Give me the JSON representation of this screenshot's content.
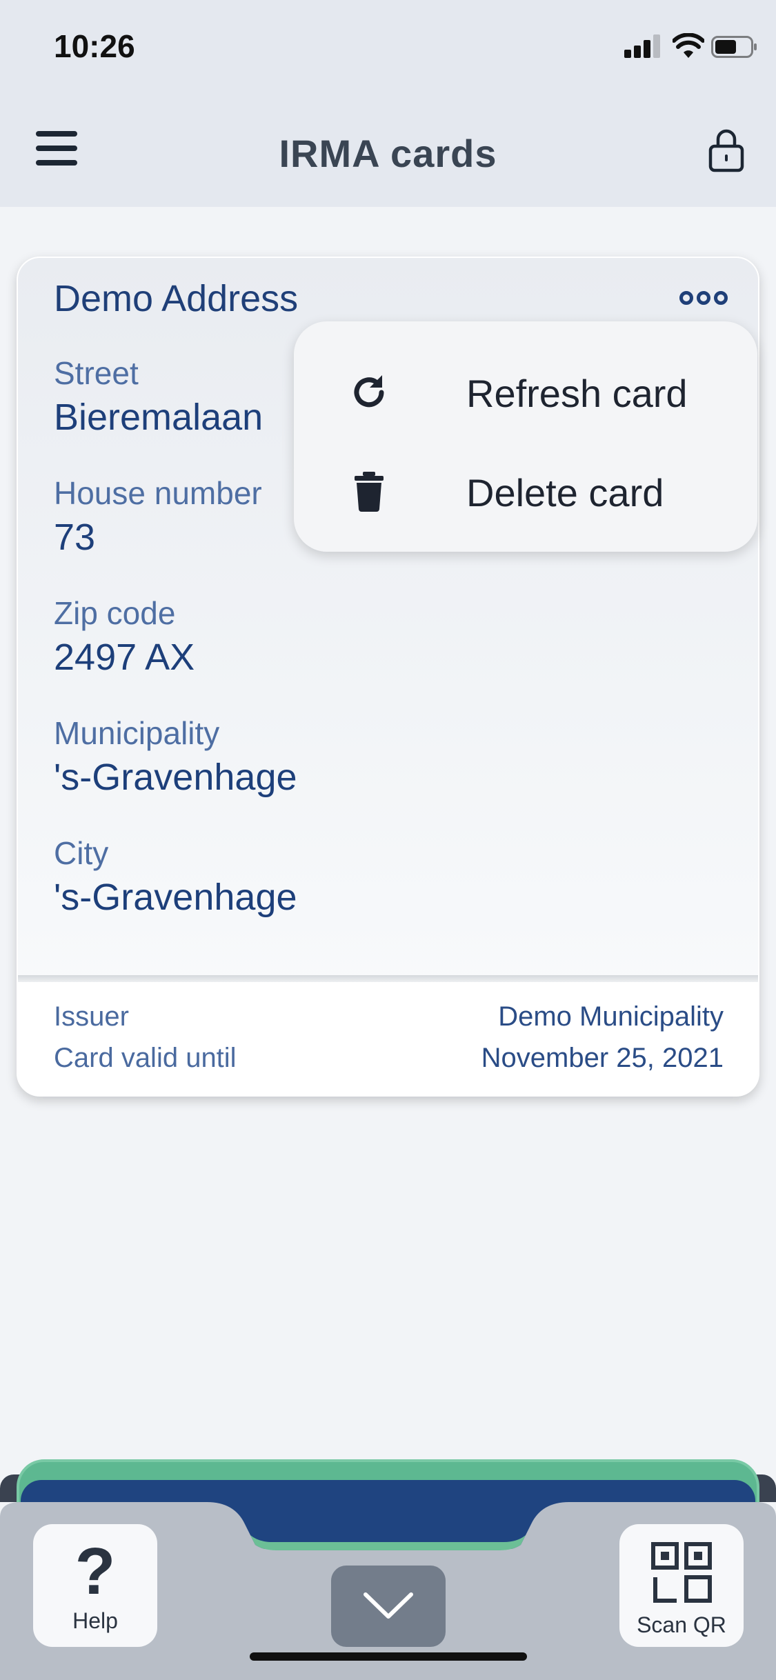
{
  "status_bar": {
    "time": "10:26"
  },
  "header": {
    "title": "IRMA cards",
    "menu_icon": "hamburger-menu-icon",
    "lock_icon": "lock-icon"
  },
  "card": {
    "title": "Demo Address",
    "attributes": [
      {
        "label": "Street",
        "value": "Bieremalaan"
      },
      {
        "label": "House number",
        "value": "73"
      },
      {
        "label": "Zip code",
        "value": "2497 AX"
      },
      {
        "label": "Municipality",
        "value": "'s-Gravenhage"
      },
      {
        "label": "City",
        "value": "'s-Gravenhage"
      }
    ],
    "footer": {
      "issuer_label": "Issuer",
      "issuer_value": "Demo Municipality",
      "valid_label": "Card valid until",
      "valid_value": "November 25, 2021"
    }
  },
  "dropdown": {
    "items": [
      {
        "label": "Refresh card",
        "icon": "refresh-icon"
      },
      {
        "label": "Delete card",
        "icon": "trash-icon"
      }
    ]
  },
  "bottom_bar": {
    "help_label": "Help",
    "help_glyph": "?",
    "scan_label": "Scan QR"
  },
  "colors": {
    "card_text": "#1f3f78",
    "header_bg": "#e4e8ef",
    "page_bg": "#f2f4f7",
    "green_card": "#5db891",
    "blue_card": "#1f4480",
    "tab_bar": "#b8bec7"
  }
}
